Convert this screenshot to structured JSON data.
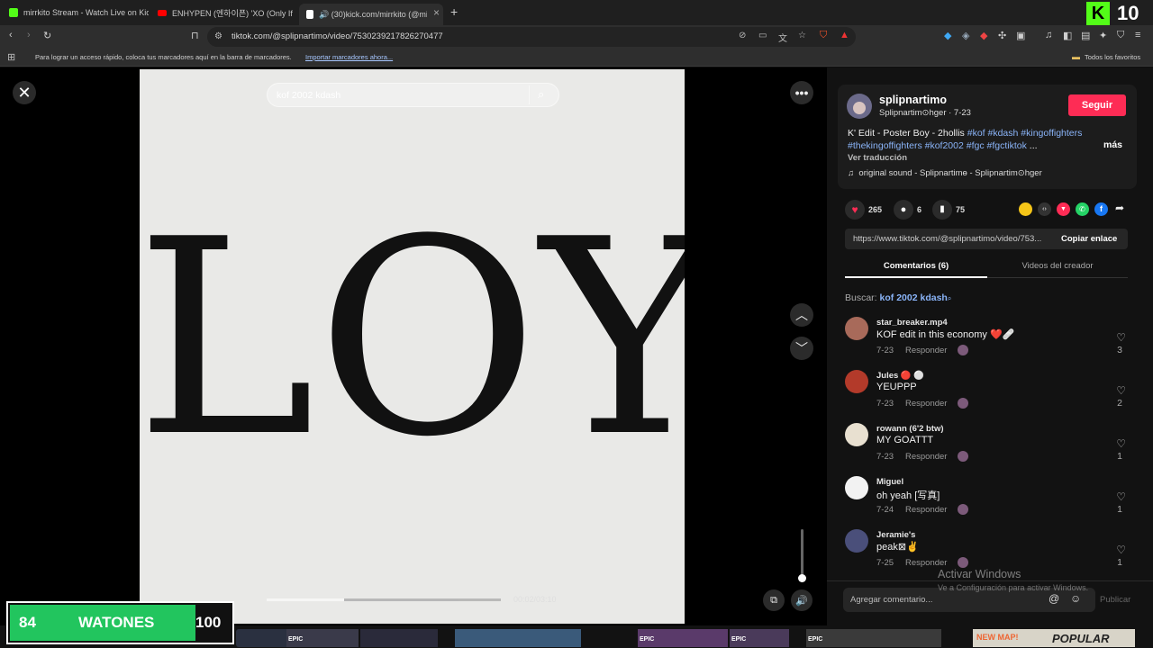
{
  "tabs": [
    {
      "title": "mirrkito Stream - Watch Live on Kick",
      "color": "#53fc18"
    },
    {
      "title": "ENHYPEN (엔하이픈) 'XO (Only If Yo",
      "color": "#ff0000"
    },
    {
      "title": "🔊 (30)kick.com/mirrkito (@mirrk",
      "color": "#ffffff"
    }
  ],
  "new_tab": "+",
  "address": "tiktok.com/@splipnartimo/video/7530239217826270477",
  "bookmarks_bar": {
    "message": "Para lograr un acceso rápido, coloca tus marcadores aquí en la barra de marcadores.",
    "import_link": "Importar marcadores ahora...",
    "all_favorites": "Todos los favoritos"
  },
  "overlay_logo_count": "10",
  "search": {
    "value": "kof 2002 kdash"
  },
  "video": {
    "text": "LOY",
    "time": "00:02/03:10",
    "progress": 0.33
  },
  "creator": {
    "username": "splipnartimo",
    "display": "Splipnartim⊙hger · 7-23",
    "follow": "Seguir",
    "caption_plain": "K' Edit - Poster Boy - 2hollis ",
    "caption_tags_1": "#kof #kdash #kingoffighters",
    "caption_tags_2": "#thekingoffighters #kof2002 #fgc #fgctiktok",
    "ellipsis": " ...",
    "more": "más",
    "translate": "Ver traducción",
    "sound": "original sound - Splipnartimө - Splipnartim⊙hger"
  },
  "stats": {
    "likes": "265",
    "comments": "6",
    "saves": "75"
  },
  "share_colors": [
    "#f5c518",
    "#333333",
    "#fe2c55",
    "#25d366",
    "#1877f2"
  ],
  "link": {
    "url": "https://www.tiktok.com/@splipnartimo/video/753...",
    "copy": "Copiar enlace"
  },
  "panel_tabs": {
    "comments": "Comentarios (6)",
    "creator_videos": "Videos del creador"
  },
  "search_label": {
    "prefix": "Buscar:",
    "query": "kof 2002 kdash"
  },
  "comments": [
    {
      "user": "star_breaker.mp4",
      "text": "KOF edit in this economy ❤️🩹",
      "date": "7-23",
      "reply": "Responder",
      "likes": "3",
      "avatar": "#a86a5a"
    },
    {
      "user": "Jules 🔴 ⚪",
      "text": "YEUPPP",
      "date": "7-23",
      "reply": "Responder",
      "likes": "2",
      "avatar": "#b33a2a"
    },
    {
      "user": "rowann (6'2 btw)",
      "text": "MY GOATTT",
      "date": "7-23",
      "reply": "Responder",
      "likes": "1",
      "avatar": "#e8e0d0"
    },
    {
      "user": "Miguel",
      "text": "oh yeah [写真]",
      "date": "7-24",
      "reply": "Responder",
      "likes": "1",
      "avatar": "#f2f2f2"
    },
    {
      "user": "Jeramie's",
      "text": "peak⊠✌",
      "date": "7-25",
      "reply": "Responder",
      "likes": "1",
      "avatar": "#4a4f7a"
    }
  ],
  "add_comment": {
    "placeholder": "Agregar comentario...",
    "publish": "Publicar"
  },
  "watermark": {
    "title": "Activar Windows",
    "subtitle": "Ve a Configuración para activar Windows."
  },
  "overlay_bar": {
    "left": "84",
    "label": "WATONES",
    "right": "100",
    "fill": 0.84
  },
  "taskbar_labels": [
    "EPIC",
    "EPIC",
    "EPIC",
    "EPIC",
    "NEW MAP!",
    "POPULAR"
  ]
}
